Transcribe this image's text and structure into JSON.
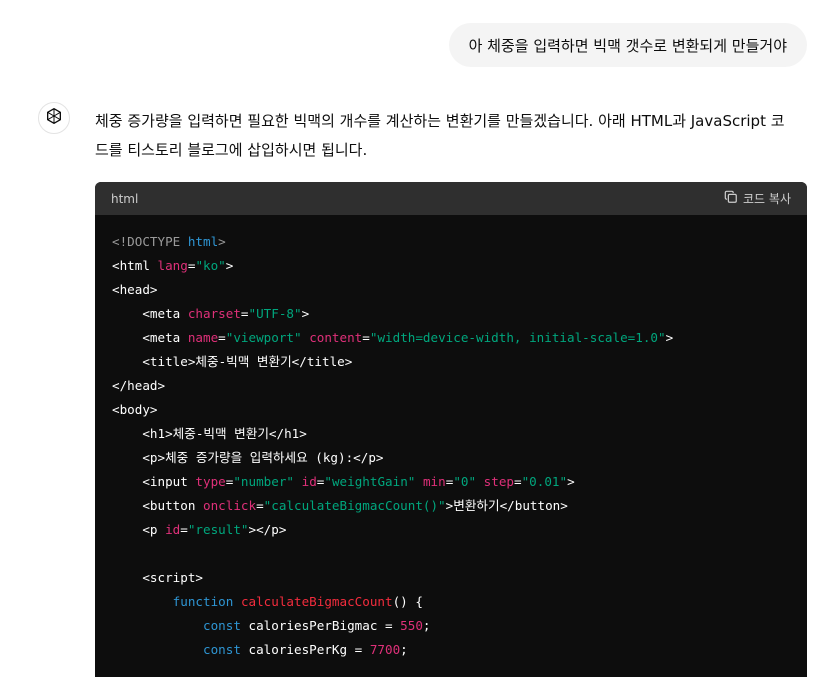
{
  "user_message": "아 체중을 입력하면 빅맥 갯수로 변환되게 만들거야",
  "assistant": {
    "avatar_icon": "chatgpt-logo-icon",
    "intro_text": "체중 증가량을 입력하면 필요한 빅맥의 개수를 계산하는 변환기를 만들겠습니다. 아래 HTML과 JavaScript 코드를 티스토리 블로그에 삽입하시면 됩니다."
  },
  "code_block": {
    "language": "html",
    "copy_label": "코드 복사",
    "copy_icon": "copy-icon",
    "colors": {
      "header_bg": "#2f2f2f",
      "body_bg": "#0d0d0d",
      "attr": "#df3079",
      "string": "#00a67d",
      "keyword": "#2e95d3",
      "function": "#f22c3d"
    },
    "lines": [
      {
        "tokens": [
          {
            "t": "<!DOCTYPE ",
            "c": "dim"
          },
          {
            "t": "html",
            "c": "kw"
          },
          {
            "t": ">",
            "c": "dim"
          }
        ]
      },
      {
        "tokens": [
          {
            "t": "<html ",
            "c": "tag"
          },
          {
            "t": "lang",
            "c": "attr"
          },
          {
            "t": "=",
            "c": "tag"
          },
          {
            "t": "\"ko\"",
            "c": "str"
          },
          {
            "t": ">",
            "c": "tag"
          }
        ]
      },
      {
        "tokens": [
          {
            "t": "<head>",
            "c": "tag"
          }
        ]
      },
      {
        "tokens": [
          {
            "t": "    <meta ",
            "c": "tag"
          },
          {
            "t": "charset",
            "c": "attr"
          },
          {
            "t": "=",
            "c": "tag"
          },
          {
            "t": "\"UTF-8\"",
            "c": "str"
          },
          {
            "t": ">",
            "c": "tag"
          }
        ]
      },
      {
        "tokens": [
          {
            "t": "    <meta ",
            "c": "tag"
          },
          {
            "t": "name",
            "c": "attr"
          },
          {
            "t": "=",
            "c": "tag"
          },
          {
            "t": "\"viewport\"",
            "c": "str"
          },
          {
            "t": " ",
            "c": "tag"
          },
          {
            "t": "content",
            "c": "attr"
          },
          {
            "t": "=",
            "c": "tag"
          },
          {
            "t": "\"width=device-width, initial-scale=1.0\"",
            "c": "str"
          },
          {
            "t": ">",
            "c": "tag"
          }
        ]
      },
      {
        "tokens": [
          {
            "t": "    <title>체중-빅맥 변환기</title>",
            "c": "tag"
          }
        ]
      },
      {
        "tokens": [
          {
            "t": "</head>",
            "c": "tag"
          }
        ]
      },
      {
        "tokens": [
          {
            "t": "<body>",
            "c": "tag"
          }
        ]
      },
      {
        "tokens": [
          {
            "t": "    <h1>체중-빅맥 변환기</h1>",
            "c": "tag"
          }
        ]
      },
      {
        "tokens": [
          {
            "t": "    <p>체중 증가량을 입력하세요 (kg):</p>",
            "c": "tag"
          }
        ]
      },
      {
        "tokens": [
          {
            "t": "    <input ",
            "c": "tag"
          },
          {
            "t": "type",
            "c": "attr"
          },
          {
            "t": "=",
            "c": "tag"
          },
          {
            "t": "\"number\"",
            "c": "str"
          },
          {
            "t": " ",
            "c": "tag"
          },
          {
            "t": "id",
            "c": "attr"
          },
          {
            "t": "=",
            "c": "tag"
          },
          {
            "t": "\"weightGain\"",
            "c": "str"
          },
          {
            "t": " ",
            "c": "tag"
          },
          {
            "t": "min",
            "c": "attr"
          },
          {
            "t": "=",
            "c": "tag"
          },
          {
            "t": "\"0\"",
            "c": "str"
          },
          {
            "t": " ",
            "c": "tag"
          },
          {
            "t": "step",
            "c": "attr"
          },
          {
            "t": "=",
            "c": "tag"
          },
          {
            "t": "\"0.01\"",
            "c": "str"
          },
          {
            "t": ">",
            "c": "tag"
          }
        ]
      },
      {
        "tokens": [
          {
            "t": "    <button ",
            "c": "tag"
          },
          {
            "t": "onclick",
            "c": "attr"
          },
          {
            "t": "=",
            "c": "tag"
          },
          {
            "t": "\"calculateBigmacCount()\"",
            "c": "str"
          },
          {
            "t": ">변환하기</button>",
            "c": "tag"
          }
        ]
      },
      {
        "tokens": [
          {
            "t": "    <p ",
            "c": "tag"
          },
          {
            "t": "id",
            "c": "attr"
          },
          {
            "t": "=",
            "c": "tag"
          },
          {
            "t": "\"result\"",
            "c": "str"
          },
          {
            "t": "></p>",
            "c": "tag"
          }
        ]
      },
      {
        "tokens": [
          {
            "t": "",
            "c": "tag"
          }
        ]
      },
      {
        "tokens": [
          {
            "t": "    <script>",
            "c": "tag"
          }
        ]
      },
      {
        "tokens": [
          {
            "t": "        ",
            "c": "tag"
          },
          {
            "t": "function",
            "c": "kw"
          },
          {
            "t": " ",
            "c": "tag"
          },
          {
            "t": "calculateBigmacCount",
            "c": "fn"
          },
          {
            "t": "() {",
            "c": "tag"
          }
        ]
      },
      {
        "tokens": [
          {
            "t": "            ",
            "c": "tag"
          },
          {
            "t": "const",
            "c": "kw"
          },
          {
            "t": " caloriesPerBigmac = ",
            "c": "tag"
          },
          {
            "t": "550",
            "c": "num"
          },
          {
            "t": ";",
            "c": "tag"
          }
        ]
      },
      {
        "tokens": [
          {
            "t": "            ",
            "c": "tag"
          },
          {
            "t": "const",
            "c": "kw"
          },
          {
            "t": " caloriesPerKg = ",
            "c": "tag"
          },
          {
            "t": "7700",
            "c": "num"
          },
          {
            "t": ";",
            "c": "tag"
          }
        ]
      }
    ]
  }
}
